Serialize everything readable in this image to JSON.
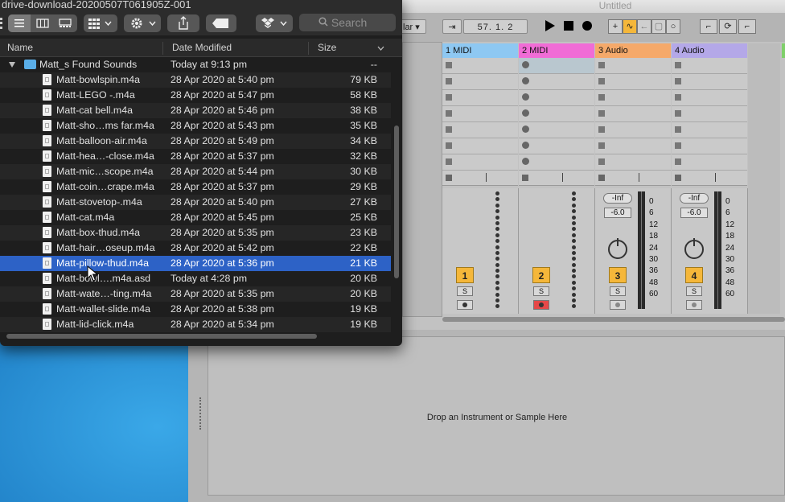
{
  "ableton": {
    "title": "Untitled",
    "toolbar": {
      "scale_dropdown": "lar ▾",
      "position": "57.  1.  2",
      "arrangement_icons": [
        "play-icon",
        "stop-icon",
        "record-icon"
      ]
    },
    "tracks": [
      {
        "name": "1 MIDI",
        "color": "#8ec8f2",
        "number": "1",
        "solo": "S",
        "type": "midi"
      },
      {
        "name": "2 MIDI",
        "color": "#f06cd6",
        "number": "2",
        "solo": "S",
        "type": "midi"
      },
      {
        "name": "3 Audio",
        "color": "#f5a96a",
        "number": "3",
        "solo": "S",
        "type": "audio",
        "sends": "-Inf",
        "volume": "-6.0"
      },
      {
        "name": "4 Audio",
        "color": "#b4a8e8",
        "number": "4",
        "solo": "S",
        "type": "audio",
        "sends": "-Inf",
        "volume": "-6.0"
      }
    ],
    "meter_scale": [
      "0",
      "6",
      "12",
      "18",
      "24",
      "30",
      "36",
      "48",
      "60"
    ],
    "detail_message": "Drop an Instrument or Sample Here"
  },
  "finder": {
    "title": "drive-download-20200507T061905Z-001",
    "search_placeholder": "Search",
    "columns": {
      "name": "Name",
      "date": "Date Modified",
      "size": "Size"
    },
    "folder": {
      "name": "Matt_s Found Sounds",
      "date": "Today at 9:13 pm",
      "size": "--"
    },
    "files": [
      {
        "name": "Matt-bowlspin.m4a",
        "date": "28 Apr 2020 at 5:40 pm",
        "size": "79 KB"
      },
      {
        "name": "Matt-LEGO -.m4a",
        "date": "28 Apr 2020 at 5:47 pm",
        "size": "58 KB"
      },
      {
        "name": "Matt-cat bell.m4a",
        "date": "28 Apr 2020 at 5:46 pm",
        "size": "38 KB"
      },
      {
        "name": "Matt-sho…ms far.m4a",
        "date": "28 Apr 2020 at 5:43 pm",
        "size": "35 KB"
      },
      {
        "name": "Matt-balloon-air.m4a",
        "date": "28 Apr 2020 at 5:49 pm",
        "size": "34 KB"
      },
      {
        "name": "Matt-hea…-close.m4a",
        "date": "28 Apr 2020 at 5:37 pm",
        "size": "32 KB"
      },
      {
        "name": "Matt-mic…scope.m4a",
        "date": "28 Apr 2020 at 5:44 pm",
        "size": "30 KB"
      },
      {
        "name": "Matt-coin…crape.m4a",
        "date": "28 Apr 2020 at 5:37 pm",
        "size": "29 KB"
      },
      {
        "name": "Matt-stovetop-.m4a",
        "date": "28 Apr 2020 at 5:40 pm",
        "size": "27 KB"
      },
      {
        "name": "Matt-cat.m4a",
        "date": "28 Apr 2020 at 5:45 pm",
        "size": "25 KB"
      },
      {
        "name": "Matt-box-thud.m4a",
        "date": "28 Apr 2020 at 5:35 pm",
        "size": "23 KB"
      },
      {
        "name": "Matt-hair…oseup.m4a",
        "date": "28 Apr 2020 at 5:42 pm",
        "size": "22 KB"
      },
      {
        "name": "Matt-pillow-thud.m4a",
        "date": "28 Apr 2020 at 5:36 pm",
        "size": "21 KB",
        "selected": true
      },
      {
        "name": "Matt-bowl….m4a.asd",
        "date": "Today at 4:28 pm",
        "size": "20 KB"
      },
      {
        "name": "Matt-wate…-ting.m4a",
        "date": "28 Apr 2020 at 5:35 pm",
        "size": "20 KB"
      },
      {
        "name": "Matt-wallet-slide.m4a",
        "date": "28 Apr 2020 at 5:38 pm",
        "size": "19 KB"
      },
      {
        "name": "Matt-lid-click.m4a",
        "date": "28 Apr 2020 at 5:34 pm",
        "size": "19 KB"
      }
    ]
  }
}
